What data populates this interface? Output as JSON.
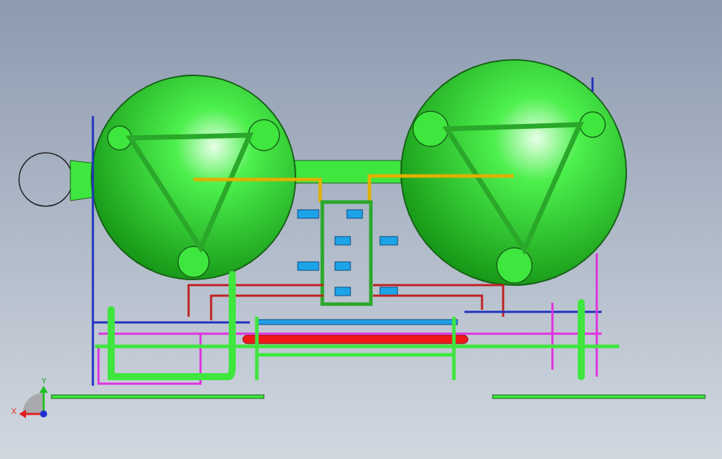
{
  "axis_triad": {
    "x_label": "X",
    "y_label": "Y"
  }
}
